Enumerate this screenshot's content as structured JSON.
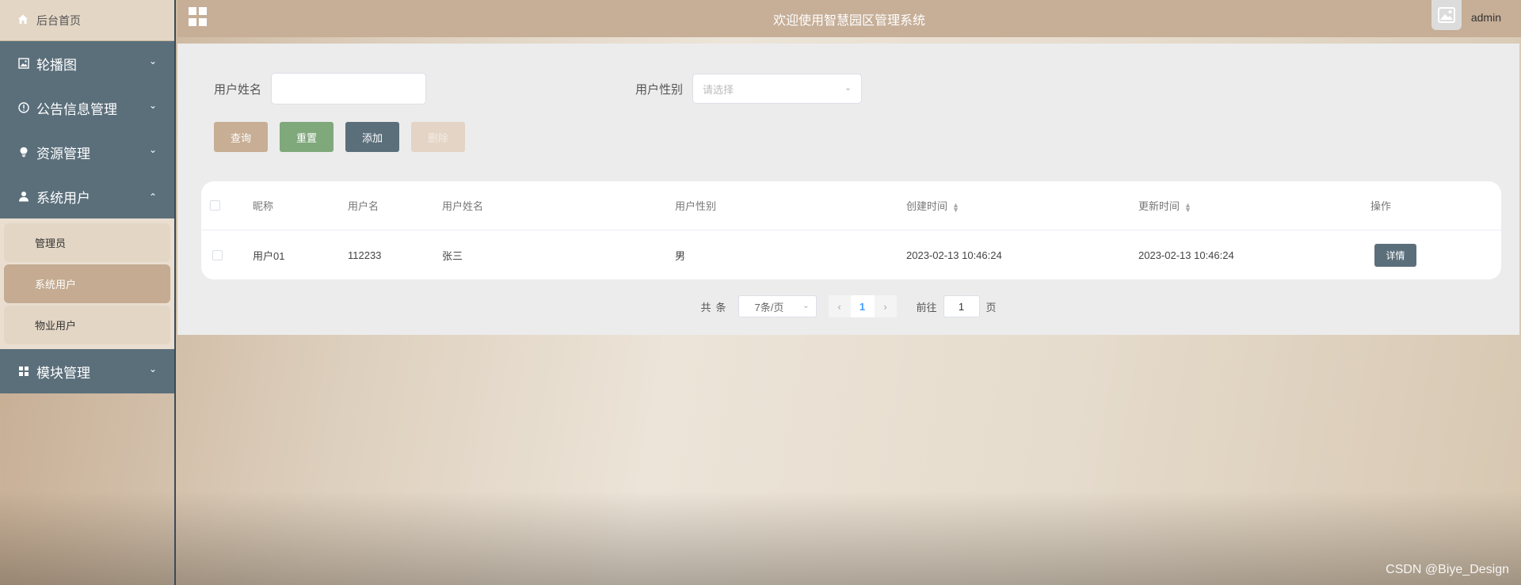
{
  "app": {
    "title": "欢迎使用智慧园区管理系统",
    "username": "admin",
    "watermark": "CSDN @Biye_Design"
  },
  "sidebar": {
    "home": "后台首页",
    "items": [
      {
        "label": "轮播图",
        "icon": "image-icon",
        "expanded": false
      },
      {
        "label": "公告信息管理",
        "icon": "info-icon",
        "expanded": false
      },
      {
        "label": "资源管理",
        "icon": "bulb-icon",
        "expanded": false
      },
      {
        "label": "系统用户",
        "icon": "user-icon",
        "expanded": true
      },
      {
        "label": "模块管理",
        "icon": "grid-icon",
        "expanded": false
      }
    ],
    "submenu": [
      {
        "label": "管理员",
        "active": false
      },
      {
        "label": "系统用户",
        "active": true
      },
      {
        "label": "物业用户",
        "active": false
      }
    ]
  },
  "search": {
    "name_label": "用户姓名",
    "name_value": "",
    "gender_label": "用户性别",
    "gender_placeholder": "请选择"
  },
  "buttons": {
    "search": "查询",
    "reset": "重置",
    "add": "添加",
    "delete": "删除"
  },
  "table": {
    "columns": [
      "昵称",
      "用户名",
      "用户姓名",
      "用户性别",
      "创建时间",
      "更新时间",
      "操作"
    ],
    "rows": [
      {
        "nickname": "用户01",
        "username": "112233",
        "realname": "张三",
        "gender": "男",
        "created": "2023-02-13 10:46:24",
        "updated": "2023-02-13 10:46:24",
        "action": "详情"
      }
    ]
  },
  "pagination": {
    "total_prefix": "共",
    "total_suffix": "条",
    "page_size": "7条/页",
    "current_page": "1",
    "goto_label": "前往",
    "goto_value": "1",
    "goto_suffix": "页"
  },
  "colors": {
    "header": "#c6ae97",
    "sidebar_menu": "#5b6f7b",
    "submenu_active": "#c4ab91",
    "btn_reset": "#7fa87b"
  }
}
